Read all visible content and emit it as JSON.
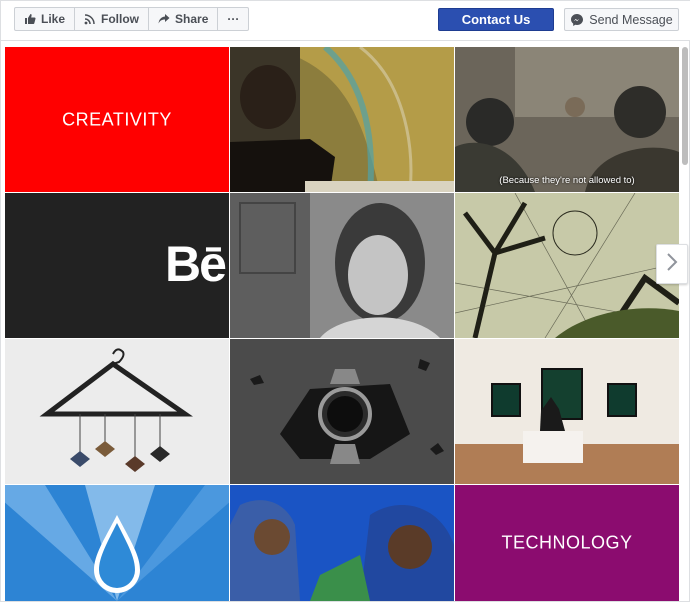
{
  "actions": {
    "like_label": "Like",
    "follow_label": "Follow",
    "share_label": "Share",
    "more_label": "···",
    "contact_label": "Contact Us",
    "message_label": "Send Message"
  },
  "tiles": {
    "creativity_label": "CREATIVITY",
    "behance_mark": "Bē",
    "caption": "(Because they're not allowed to)",
    "technology_label": "TECHNOLOGY"
  },
  "colors": {
    "contact_bg": "#2b4fb0",
    "creativity_bg": "#ff0000",
    "behance_bg": "#222222",
    "technology_bg": "#8b0c6f"
  }
}
